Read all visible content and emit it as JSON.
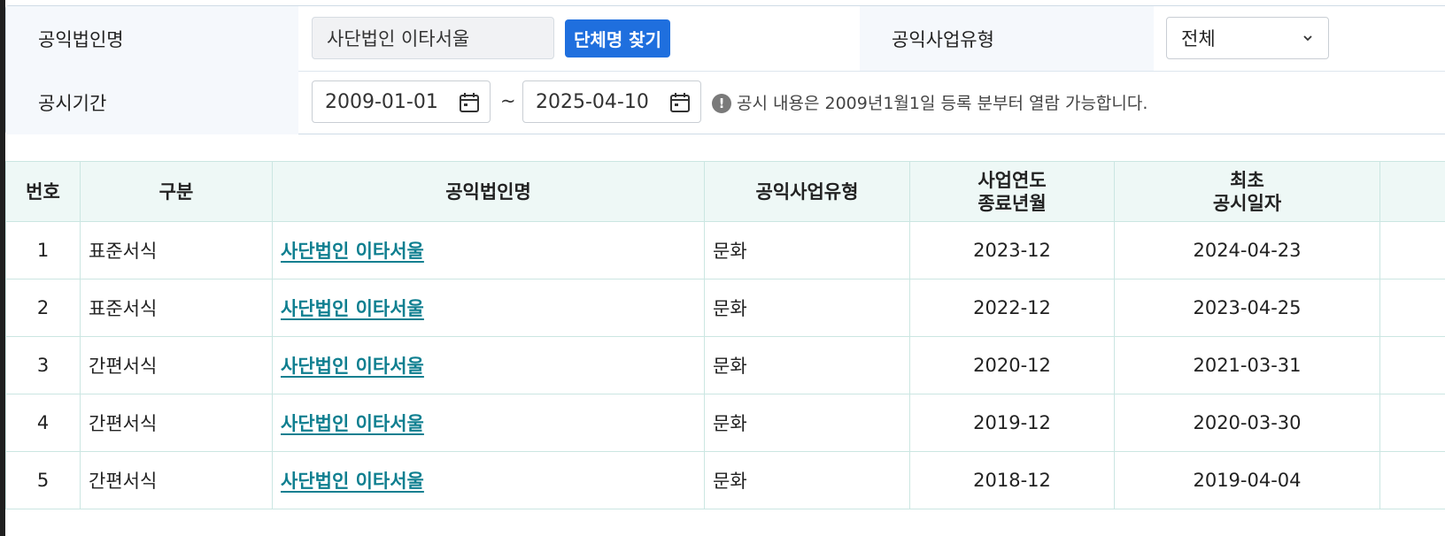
{
  "search": {
    "corp_name_label": "공익법인명",
    "corp_name_value": "사단법인 이타서울",
    "find_button_label": "단체명 찾기",
    "business_type_label": "공익사업유형",
    "business_type_value": "전체",
    "period_label": "공시기간",
    "start_date": "2009-01-01",
    "date_separator": "~",
    "end_date": "2025-04-10",
    "notice": "공시 내용은 2009년1월1일 등록 분부터 열람 가능합니다."
  },
  "table": {
    "headers": {
      "no": "번호",
      "category": "구분",
      "corp_name": "공익법인명",
      "business_type": "공익사업유형",
      "fiscal_end_line1": "사업연도",
      "fiscal_end_line2": "종료년월",
      "first_disclosure_line1": "최초",
      "first_disclosure_line2": "공시일자"
    },
    "rows": [
      {
        "no": "1",
        "category": "표준서식",
        "corp_name": "사단법인 이타서울",
        "business_type": "문화",
        "fiscal_end": "2023-12",
        "first_disclosure": "2024-04-23"
      },
      {
        "no": "2",
        "category": "표준서식",
        "corp_name": "사단법인 이타서울",
        "business_type": "문화",
        "fiscal_end": "2022-12",
        "first_disclosure": "2023-04-25"
      },
      {
        "no": "3",
        "category": "간편서식",
        "corp_name": "사단법인 이타서울",
        "business_type": "문화",
        "fiscal_end": "2020-12",
        "first_disclosure": "2021-03-31"
      },
      {
        "no": "4",
        "category": "간편서식",
        "corp_name": "사단법인 이타서울",
        "business_type": "문화",
        "fiscal_end": "2019-12",
        "first_disclosure": "2020-03-30"
      },
      {
        "no": "5",
        "category": "간편서식",
        "corp_name": "사단법인 이타서울",
        "business_type": "문화",
        "fiscal_end": "2018-12",
        "first_disclosure": "2019-04-04"
      }
    ]
  },
  "colors": {
    "primary_button": "#1f6fde",
    "link": "#0f7f90",
    "table_header_bg": "#eef8f6",
    "table_border": "#cbe6e2"
  },
  "icons": {
    "select_arrow": "chevron-down-icon",
    "date_picker": "calendar-icon",
    "notice": "info-icon"
  }
}
